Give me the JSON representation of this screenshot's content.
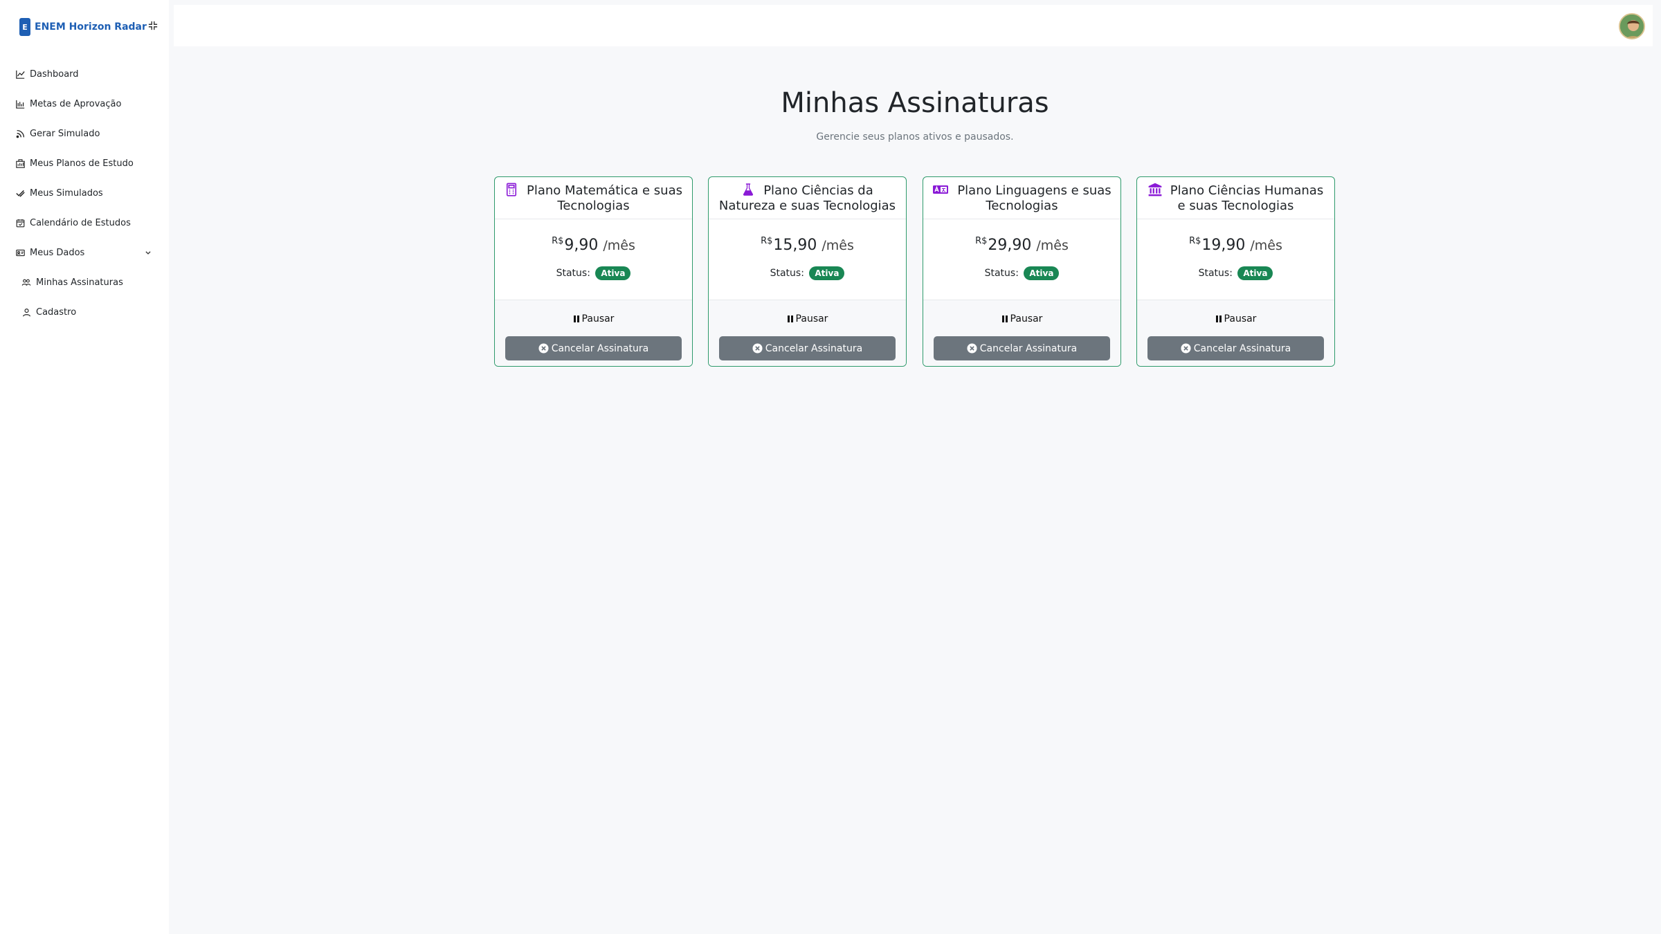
{
  "brand": {
    "logo_letter": "E",
    "name": "ENEM Horizon Radar"
  },
  "sidebar": {
    "items": [
      {
        "label": "Dashboard",
        "icon": "chart-line-icon"
      },
      {
        "label": "Metas de Aprovação",
        "icon": "bar-chart-icon"
      },
      {
        "label": "Gerar Simulado",
        "icon": "rss-icon"
      },
      {
        "label": "Meus Planos de Estudo",
        "icon": "clipboard-data-icon"
      },
      {
        "label": "Meus Simulados",
        "icon": "check-all-icon"
      },
      {
        "label": "Calendário de Estudos",
        "icon": "calendar-check-icon"
      },
      {
        "label": "Meus Dados",
        "icon": "person-vcard-icon",
        "expanded": true
      },
      {
        "label": "Minhas Assinaturas",
        "icon": "people-icon",
        "sub": true
      },
      {
        "label": "Cadastro",
        "icon": "person-icon",
        "sub": true
      }
    ]
  },
  "page": {
    "title": "Minhas Assinaturas",
    "subtitle": "Gerencie seus planos ativos e pausados."
  },
  "plans": [
    {
      "title": "Plano Matemática e suas Tecnologias",
      "icon": "calculator-icon",
      "currency": "R$",
      "price": "9,90",
      "period": "/mês",
      "status_label": "Status:",
      "status": "Ativa",
      "pause_label": "Pausar",
      "cancel_label": "Cancelar Assinatura"
    },
    {
      "title": "Plano Ciências da Natureza e suas Tecnologias",
      "icon": "flask-icon",
      "currency": "R$",
      "price": "15,90",
      "period": "/mês",
      "status_label": "Status:",
      "status": "Ativa",
      "pause_label": "Pausar",
      "cancel_label": "Cancelar Assinatura"
    },
    {
      "title": "Plano Linguagens e suas Tecnologias",
      "icon": "translate-icon",
      "currency": "R$",
      "price": "29,90",
      "period": "/mês",
      "status_label": "Status:",
      "status": "Ativa",
      "pause_label": "Pausar",
      "cancel_label": "Cancelar Assinatura"
    },
    {
      "title": "Plano Ciências Humanas e suas Tecnologias",
      "icon": "bank-icon",
      "currency": "R$",
      "price": "19,90",
      "period": "/mês",
      "status_label": "Status:",
      "status": "Ativa",
      "pause_label": "Pausar",
      "cancel_label": "Cancelar Assinatura"
    }
  ],
  "colors": {
    "brand": "#1e5fb4",
    "card_border": "#2e9a6b",
    "badge": "#198754",
    "cancel_button": "#6c757d",
    "plan_icon": "#8a1ad6"
  }
}
